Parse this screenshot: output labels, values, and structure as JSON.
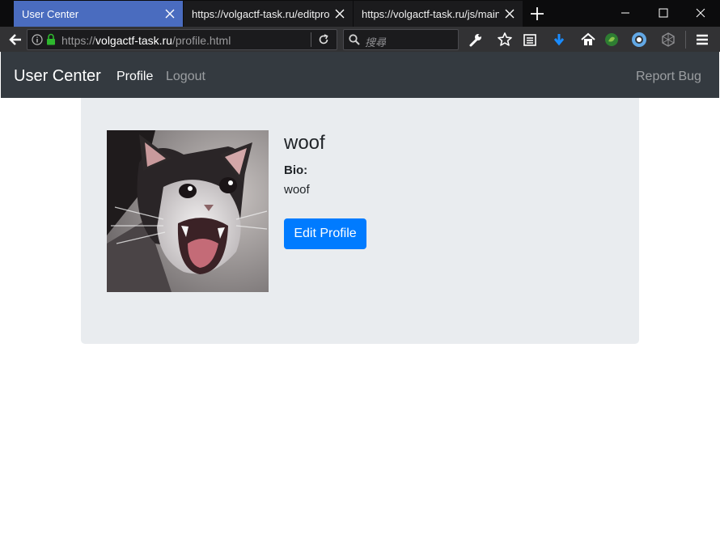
{
  "browser": {
    "tabs": [
      {
        "title": "User Center",
        "active": true
      },
      {
        "title": "https://volgactf-task.ru/editpro",
        "active": false
      },
      {
        "title": "https://volgactf-task.ru/js/main",
        "active": false
      }
    ],
    "url": {
      "scheme": "https://",
      "host": "volgactf-task.ru",
      "path": "/profile.html"
    },
    "search_placeholder": "搜尋",
    "accent_color": "#4a6cbf"
  },
  "navbar": {
    "brand": "User Center",
    "links": {
      "profile": "Profile",
      "logout": "Logout",
      "report_bug": "Report Bug"
    }
  },
  "profile": {
    "username": "woof",
    "bio_label": "Bio:",
    "bio": "woof",
    "edit_button": "Edit Profile",
    "avatar_icon": "crying-cat-photo"
  }
}
